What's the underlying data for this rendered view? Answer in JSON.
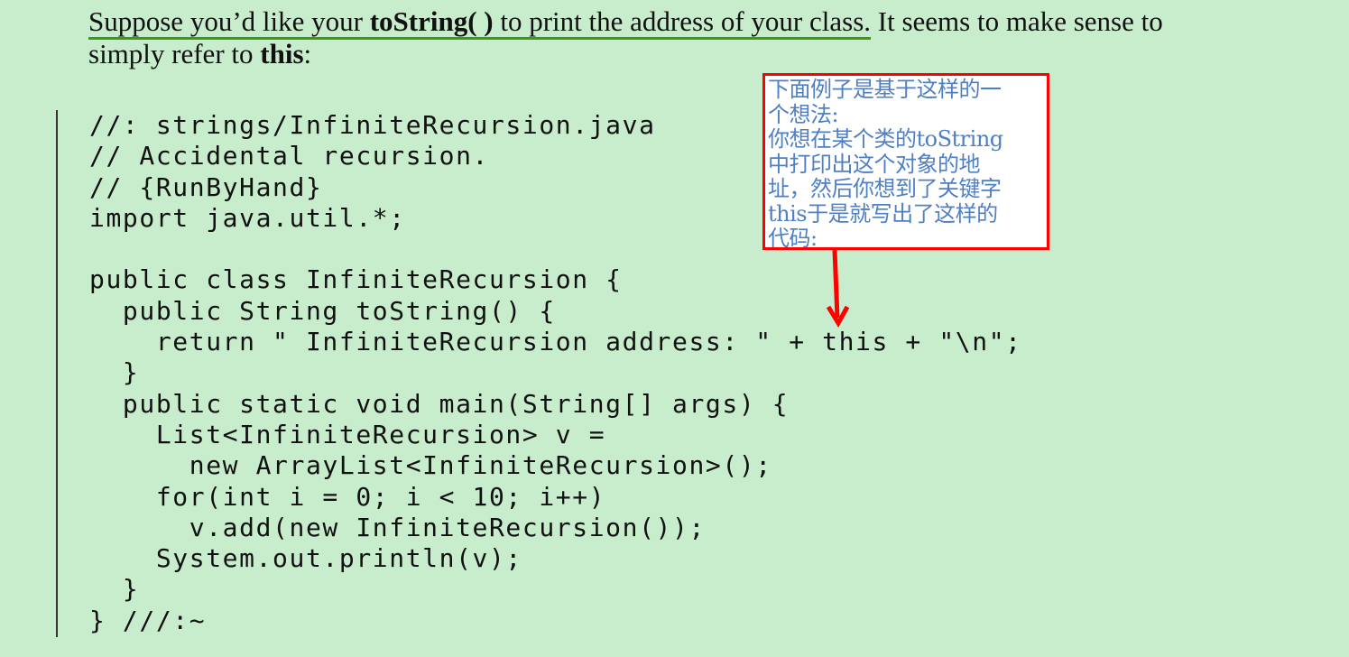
{
  "intro": {
    "highlighted_pre": "Suppose you’d like your ",
    "highlighted_bold": "toString( )",
    "highlighted_post": " to print the address of your class.",
    "rest": " It seems to make sense to simply refer to ",
    "bold_this": "this",
    "end": ":"
  },
  "code": {
    "lines": [
      "//: strings/InfiniteRecursion.java",
      "// Accidental recursion.",
      "// {RunByHand}",
      "import java.util.*;",
      "",
      "public class InfiniteRecursion {",
      "  public String toString() {",
      "    return \" InfiniteRecursion address: \" + this + \"\\n\";",
      "  }",
      "  public static void main(String[] args) {",
      "    List<InfiniteRecursion> v =",
      "      new ArrayList<InfiniteRecursion>();",
      "    for(int i = 0; i < 10; i++)",
      "      v.add(new InfiniteRecursion());",
      "    System.out.println(v);",
      "  }",
      "} ///:~"
    ]
  },
  "annotation": {
    "lines": [
      "下面例子是基于这样的一",
      "个想法:",
      "你想在某个类的toString",
      "中打印出这个对象的地",
      "址，然后你想到了关键字",
      "this于是就写出了这样的",
      "代码:"
    ],
    "border_color": "#ff0000",
    "text_color": "#4f7fc4",
    "arrow_color": "#ff0000"
  },
  "colors": {
    "page_background": "#c8edcd",
    "highlight_underline": "#3a9b10"
  }
}
